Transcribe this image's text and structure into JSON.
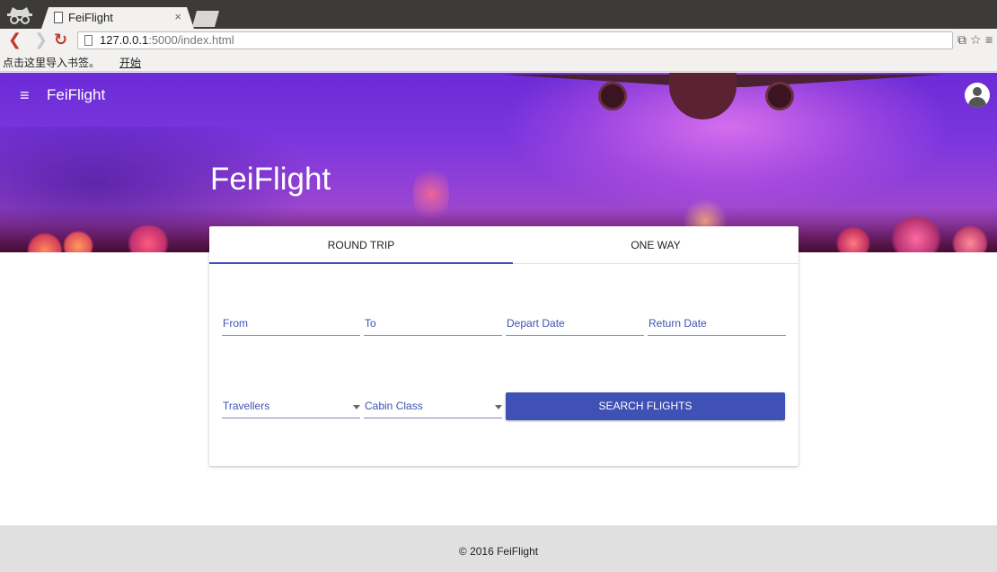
{
  "browser": {
    "tab_title": "FeiFlight",
    "tab_close": "×",
    "url_host": "127.0.0.1",
    "url_rest": ":5000/index.html",
    "bookmarks_prompt": "点击这里导入书签。",
    "bookmarks_link": "开始",
    "icons": [
      "incognito-icon",
      "page-icon",
      "back-icon",
      "forward-icon",
      "reload-icon",
      "translate-icon",
      "star-icon",
      "menu-icon"
    ]
  },
  "appbar": {
    "title": "FeiFlight",
    "menu_glyph": "≡"
  },
  "hero": {
    "title": "FeiFlight"
  },
  "search_card": {
    "tabs": [
      "ROUND TRIP",
      "ONE WAY"
    ],
    "active_tab": "ROUND TRIP",
    "fields": {
      "from": "From",
      "to": "To",
      "depart_date": "Depart Date",
      "return_date": "Return Date"
    },
    "selects": {
      "travellers": "Travellers",
      "cabin_class": "Cabin Class"
    },
    "search_button": "SEARCH FLIGHTS"
  },
  "footer": {
    "text": "© 2016 FeiFlight"
  },
  "colors": {
    "primary": "#3f51b5",
    "hero_purple": "#7a35dd",
    "footer_bg": "#e0e0e0"
  }
}
